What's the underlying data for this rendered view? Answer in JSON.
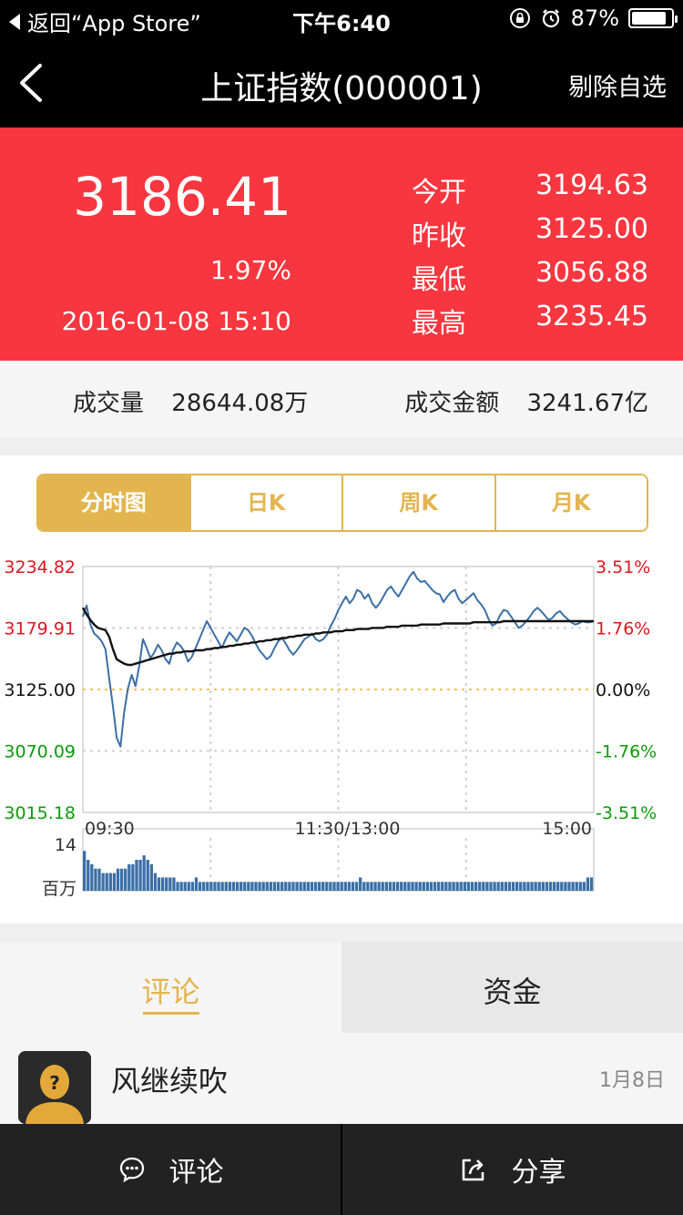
{
  "status": {
    "back_label": "返回“App Store”",
    "time": "下午6:40",
    "battery": "87%",
    "battery_level": 0.87
  },
  "nav": {
    "title": "上证指数(000001)",
    "action": "剔除自选"
  },
  "quote": {
    "price": "3186.41",
    "change_pct": "1.97%",
    "datetime": "2016-01-08 15:10",
    "stats": [
      {
        "label": "今开",
        "value": "3194.63"
      },
      {
        "label": "昨收",
        "value": "3125.00"
      },
      {
        "label": "最低",
        "value": "3056.88"
      },
      {
        "label": "最高",
        "value": "3235.45"
      }
    ]
  },
  "volume": {
    "label": "成交量",
    "value": "28644.08万",
    "amount_label": "成交金额",
    "amount_value": "3241.67亿"
  },
  "chart_tabs": [
    "分时图",
    "日K",
    "周K",
    "月K"
  ],
  "chart_tab_active": 0,
  "chart_data": {
    "type": "line",
    "y_left_ticks": [
      "3234.82",
      "3179.91",
      "3125.00",
      "3070.09",
      "3015.18"
    ],
    "y_right_ticks": [
      "3.51%",
      "1.76%",
      "0.00%",
      "-1.76%",
      "-3.51%"
    ],
    "x_ticks": [
      "09:30",
      "11:30/13:00",
      "15:00"
    ],
    "ylim": [
      3015.18,
      3234.82
    ],
    "base_price": 3125.0,
    "series": [
      {
        "values": [
          3190,
          3200,
          3183,
          3175,
          3172,
          3168,
          3161,
          3135,
          3110,
          3082,
          3074,
          3105,
          3126,
          3138,
          3128,
          3146,
          3170,
          3162,
          3153,
          3158,
          3165,
          3160,
          3152,
          3148,
          3160,
          3167,
          3164,
          3159,
          3150,
          3154,
          3162,
          3170,
          3178,
          3186,
          3180,
          3174,
          3168,
          3162,
          3170,
          3176,
          3172,
          3168,
          3174,
          3180,
          3178,
          3173,
          3166,
          3160,
          3156,
          3152,
          3155,
          3162,
          3168,
          3171,
          3166,
          3160,
          3156,
          3160,
          3165,
          3170,
          3172,
          3175,
          3170,
          3168,
          3170,
          3174,
          3182,
          3188,
          3196,
          3202,
          3208,
          3202,
          3206,
          3214,
          3212,
          3206,
          3210,
          3202,
          3198,
          3202,
          3208,
          3214,
          3217,
          3212,
          3208,
          3214,
          3220,
          3226,
          3230,
          3224,
          3221,
          3222,
          3218,
          3214,
          3211,
          3210,
          3203,
          3208,
          3212,
          3214,
          3206,
          3202,
          3205,
          3208,
          3211,
          3205,
          3201,
          3196,
          3188,
          3182,
          3184,
          3191,
          3196,
          3195,
          3190,
          3185,
          3180,
          3182,
          3186,
          3190,
          3195,
          3198,
          3195,
          3191,
          3187,
          3189,
          3193,
          3195,
          3191,
          3188,
          3185,
          3183,
          3184,
          3186,
          3185,
          3185,
          3186
        ]
      },
      {
        "values": [
          3198,
          3192,
          3187,
          3183,
          3180,
          3179,
          3178,
          3172,
          3161,
          3152,
          3150,
          3148,
          3147,
          3147,
          3148,
          3149,
          3150,
          3151,
          3152,
          3153,
          3154,
          3155,
          3156,
          3157,
          3157,
          3158,
          3158,
          3159,
          3159,
          3159,
          3160,
          3160,
          3160,
          3161,
          3161,
          3162,
          3162,
          3163,
          3163,
          3164,
          3164,
          3165,
          3165,
          3166,
          3166,
          3167,
          3167,
          3168,
          3168,
          3169,
          3169,
          3170,
          3170,
          3171,
          3171,
          3172,
          3172,
          3173,
          3173,
          3174,
          3174,
          3174,
          3175,
          3175,
          3176,
          3176,
          3176,
          3177,
          3177,
          3177,
          3178,
          3178,
          3178,
          3179,
          3179,
          3179,
          3179,
          3180,
          3180,
          3180,
          3180,
          3181,
          3181,
          3181,
          3181,
          3182,
          3182,
          3182,
          3182,
          3182,
          3183,
          3183,
          3183,
          3183,
          3183,
          3183,
          3184,
          3184,
          3184,
          3184,
          3184,
          3184,
          3184,
          3184,
          3185,
          3185,
          3185,
          3185,
          3185,
          3185,
          3185,
          3185,
          3186,
          3186,
          3186,
          3186,
          3186,
          3186,
          3186,
          3186,
          3186,
          3186,
          3186,
          3186,
          3186,
          3186,
          3186,
          3186,
          3186,
          3186,
          3186,
          3186,
          3186,
          3186,
          3186,
          3186,
          3186
        ]
      }
    ],
    "volume_ticks": [
      "14",
      "百万"
    ],
    "volume_values": [
      9,
      7,
      6,
      5,
      5,
      4,
      4,
      4,
      4,
      5,
      5,
      5,
      6,
      6,
      7,
      7,
      8,
      7,
      6,
      4,
      3,
      3,
      3,
      3,
      3,
      2,
      2,
      2,
      2,
      2,
      3,
      2,
      2,
      2,
      2,
      2,
      2,
      2,
      2,
      2,
      2,
      2,
      2,
      2,
      2,
      2,
      2,
      2,
      2,
      2,
      2,
      2,
      2,
      2,
      2,
      2,
      2,
      2,
      2,
      2,
      2,
      2,
      2,
      2,
      2,
      2,
      2,
      2,
      2,
      2,
      2,
      2,
      2,
      2,
      3,
      2,
      2,
      2,
      2,
      2,
      2,
      2,
      2,
      2,
      2,
      2,
      2,
      2,
      2,
      2,
      2,
      2,
      2,
      2,
      2,
      2,
      2,
      2,
      2,
      2,
      2,
      2,
      2,
      2,
      2,
      2,
      2,
      2,
      2,
      2,
      2,
      2,
      2,
      2,
      2,
      2,
      2,
      2,
      2,
      2,
      2,
      2,
      2,
      2,
      2,
      2,
      2,
      2,
      2,
      2,
      2,
      2,
      2,
      2,
      2,
      3,
      3
    ],
    "volume_max": 14,
    "colors": {
      "price_line": "#3b6fa6",
      "avg_line": "#111111",
      "up": "#e0161f",
      "down": "#0b9b0b",
      "grid": "#d0d0d0",
      "base": "#f0c060"
    }
  },
  "bottom_tabs": {
    "active": "评论",
    "inactive": "资金"
  },
  "comment": {
    "user": "风继续吹",
    "date": "1月8日"
  },
  "bottombar": {
    "comment_label": "评论",
    "share_label": "分享"
  }
}
